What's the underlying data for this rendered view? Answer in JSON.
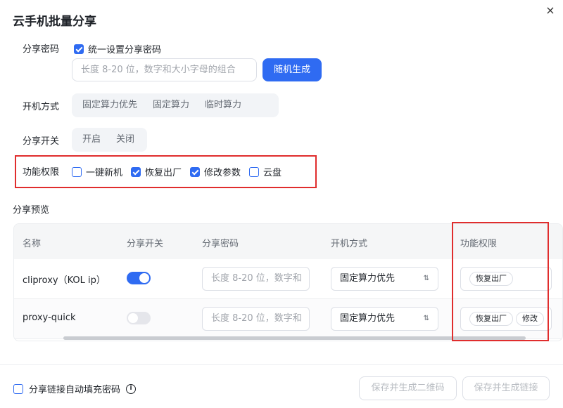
{
  "dialog": {
    "title": "云手机批量分享",
    "close_icon": "×"
  },
  "share_password": {
    "label": "分享密码",
    "unify_checkbox": {
      "label": "统一设置分享密码",
      "checked": true
    },
    "input_placeholder": "长度 8-20 位，数字和大小字母的组合",
    "random_button": "随机生成"
  },
  "boot_mode": {
    "label": "开机方式",
    "options": [
      "固定算力优先",
      "固定算力",
      "临时算力"
    ]
  },
  "share_switch": {
    "label": "分享开关",
    "options": [
      "开启",
      "关闭"
    ]
  },
  "permissions": {
    "label": "功能权限",
    "items": [
      {
        "label": "一键新机",
        "checked": false
      },
      {
        "label": "恢复出厂",
        "checked": true
      },
      {
        "label": "修改参数",
        "checked": true
      },
      {
        "label": "云盘",
        "checked": false
      }
    ]
  },
  "preview": {
    "label": "分享预览",
    "columns": [
      "名称",
      "分享开关",
      "分享密码",
      "开机方式",
      "功能权限"
    ],
    "rows": [
      {
        "name": "cliproxy（KOL ip）",
        "switch_on": true,
        "password_placeholder": "长度 8-20 位，数字和",
        "boot_mode": "固定算力优先",
        "tags": [
          "恢复出厂"
        ]
      },
      {
        "name": "proxy-quick",
        "switch_on": false,
        "password_placeholder": "长度 8-20 位，数字和",
        "boot_mode": "固定算力优先",
        "tags": [
          "恢复出厂",
          "修改"
        ]
      }
    ]
  },
  "footer": {
    "autofill_checkbox": {
      "label": "分享链接自动填充密码",
      "checked": false
    },
    "info_icon": "i",
    "qr_button": "保存并生成二维码",
    "link_button": "保存并生成链接"
  },
  "colors": {
    "accent": "#2f6bf2",
    "highlight": "#e02d2d"
  }
}
